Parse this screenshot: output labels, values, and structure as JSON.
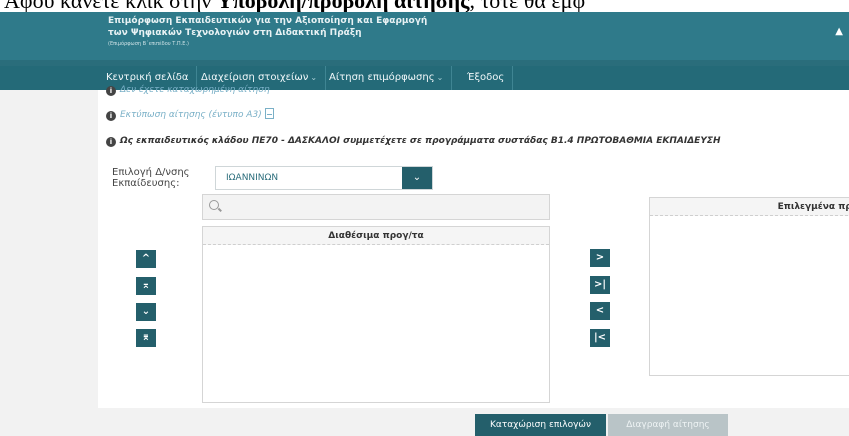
{
  "caption": {
    "prefix": "Αφού κάνετε κλικ στην ",
    "bold": "Υποβολή/προβολή αίτησης",
    "suffix": ", τότε θα εμφ"
  },
  "header": {
    "line1": "Επιμόρφωση Εκπαιδευτικών για την Αξιοποίηση και Εφαρμογή",
    "line2": "των Ψηφιακών Τεχνολογιών στη Διδακτική Πράξη",
    "line3": "(Επιμόρφωση Β΄επιπέδου Τ.Π.Ε.)",
    "user_icon": "user-icon"
  },
  "nav": {
    "items": [
      {
        "label": "Κεντρική σελίδα",
        "has_dropdown": false
      },
      {
        "label": "Διαχείριση στοιχείων",
        "has_dropdown": true
      },
      {
        "label": "Αίτηση επιμόρφωσης",
        "has_dropdown": true
      },
      {
        "label": "Έξοδος",
        "has_dropdown": false
      }
    ]
  },
  "content": {
    "line1": "Δεν έχετε καταχωρημένη αίτηση",
    "line2": "Εκτύπωση αίτησης (έντυπο Α3)",
    "line3": "Ως εκπαιδευτικός κλάδου ΠΕ70 - ΔΑΣΚΑΛΟΙ συμμετέχετε σε προγράμματα συστάδας Β1.4 ΠΡΩΤΟΒΑΘΜΙΑ ΕΚΠΑΙΔΕΥΣΗ",
    "select": {
      "label_line1": "Επιλογή Δ/νσης",
      "label_line2": "Εκπαίδευσης:",
      "value": "ΙΩΑΝΝΙΝΩΝ",
      "button": "⌄"
    },
    "search": {
      "placeholder": ""
    },
    "available_header": "Διαθέσιμα προγ/τα",
    "selected_header": "Επιλεγμένα προ",
    "order_buttons": [
      "^",
      "⌅",
      "⌄",
      "⌆"
    ],
    "move_buttons": [
      ">",
      ">|",
      "<",
      "|<"
    ],
    "save_button": "Καταχώριση επιλογών",
    "delete_button": "Διαγραφή αίτησης"
  },
  "colors": {
    "header": "#2f7a8a",
    "nav": "#246a78",
    "button": "#245f6b",
    "link": "#7ab0c7"
  }
}
